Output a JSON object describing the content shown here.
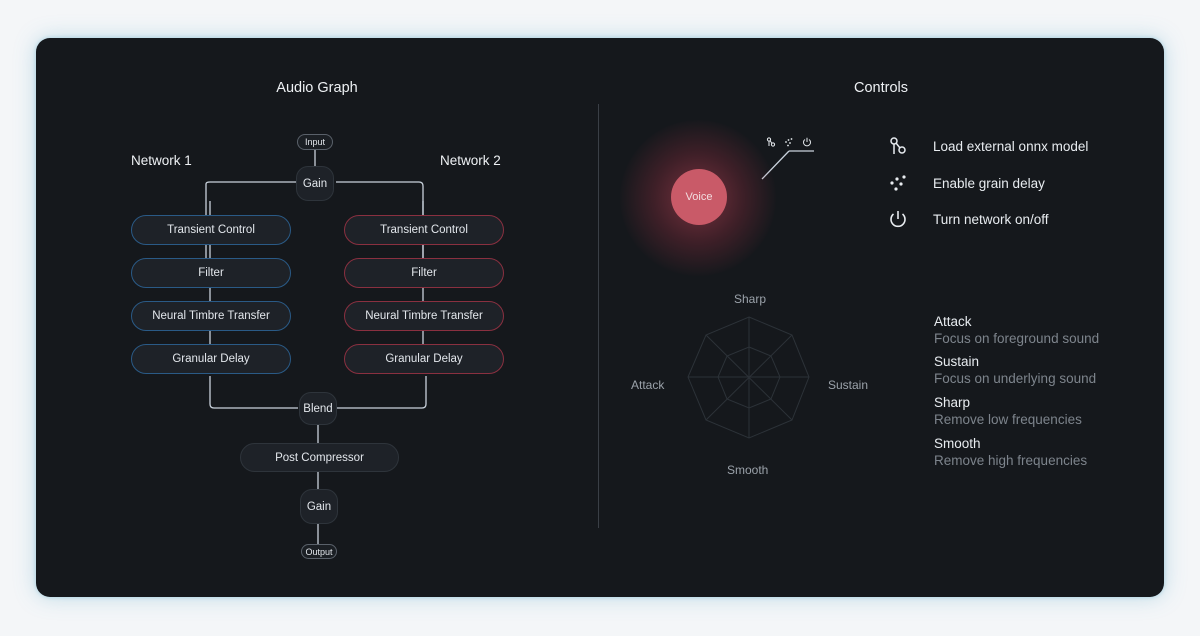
{
  "audio_graph": {
    "title": "Audio Graph",
    "network_left": "Network 1",
    "network_right": "Network 2",
    "input_label": "Input",
    "gain_label": "Gain",
    "blend_label": "Blend",
    "post_compressor_label": "Post Compressor",
    "gain_bottom_label": "Gain",
    "output_label": "Output",
    "left_modules": [
      "Transient Control",
      "Filter",
      "Neural Timbre Transfer",
      "Granular Delay"
    ],
    "right_modules": [
      "Transient Control",
      "Filter",
      "Neural Timbre Transfer",
      "Granular Delay"
    ]
  },
  "controls": {
    "title": "Controls",
    "voice_label": "Voice",
    "legend": [
      {
        "icon": "model-icon",
        "label": "Load external onnx model"
      },
      {
        "icon": "grain-icon",
        "label": "Enable grain delay"
      },
      {
        "icon": "power-icon",
        "label": "Turn network on/off"
      }
    ],
    "radar": {
      "top": "Sharp",
      "right": "Sustain",
      "bottom": "Smooth",
      "left": "Attack"
    },
    "descriptions": [
      {
        "title": "Attack",
        "sub": "Focus on foreground sound"
      },
      {
        "title": "Sustain",
        "sub": "Focus on underlying sound"
      },
      {
        "title": "Sharp",
        "sub": "Remove low frequencies"
      },
      {
        "title": "Smooth",
        "sub": "Remove high frequencies"
      }
    ]
  },
  "colors": {
    "network1_accent": "#2a5a86",
    "network2_accent": "#8a3040",
    "voice": "#c95a68",
    "line": "#c9d2dc"
  }
}
